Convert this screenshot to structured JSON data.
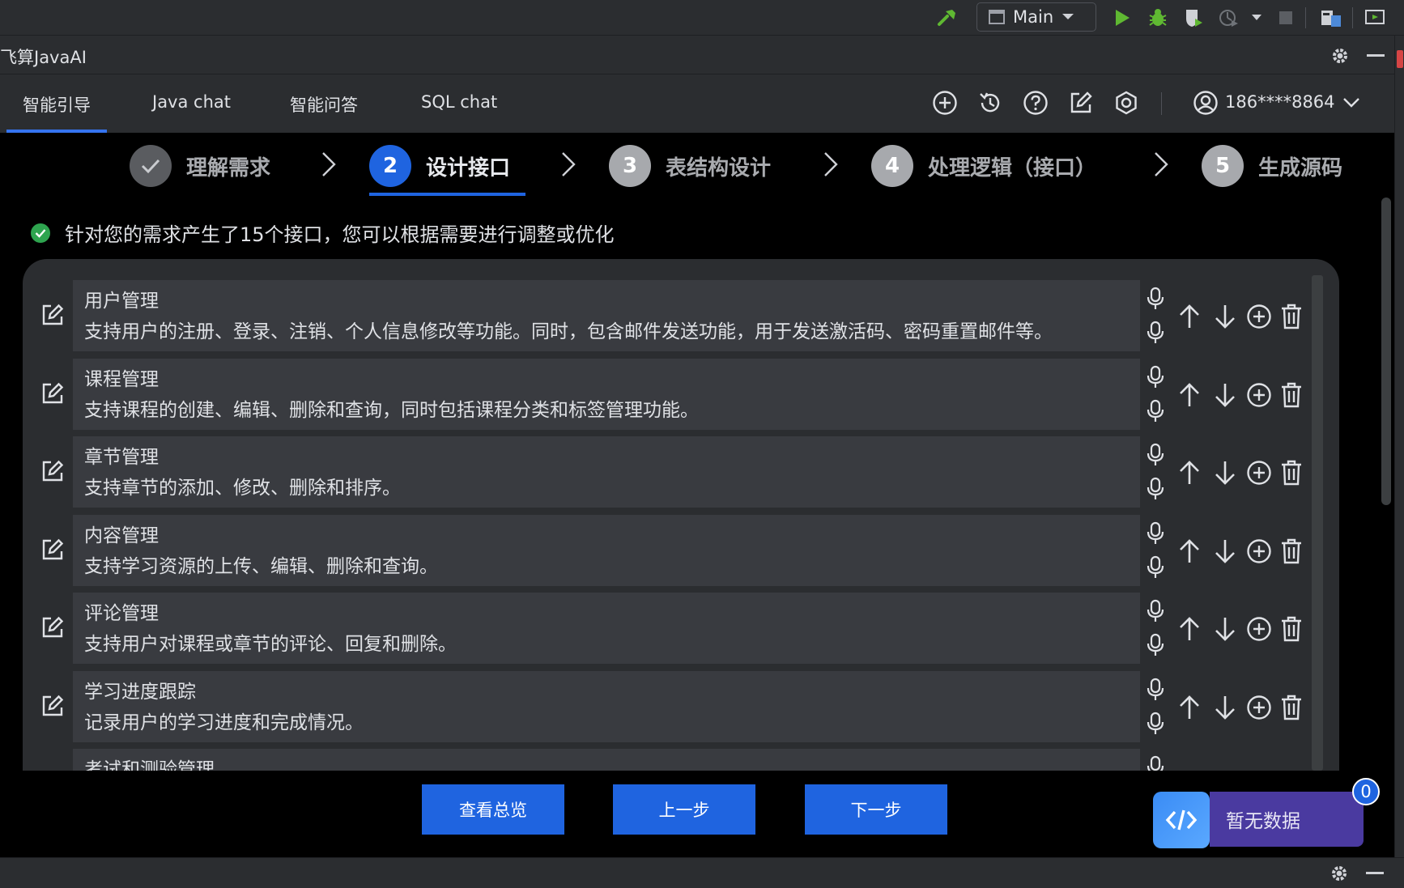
{
  "ide": {
    "run_config": "Main",
    "icons": [
      "build-hammer-icon",
      "run-icon",
      "debug-icon",
      "coverage-icon",
      "profile-icon",
      "stop-icon",
      "project-structure-icon",
      "presentation-icon"
    ]
  },
  "plugin": {
    "title": "飞算JavaAI"
  },
  "tabs": [
    {
      "label": "智能引导",
      "active": true
    },
    {
      "label": "Java chat",
      "active": false
    },
    {
      "label": "智能问答",
      "active": false
    },
    {
      "label": "SQL chat",
      "active": false
    }
  ],
  "header_actions": [
    "new-chat-icon",
    "history-icon",
    "help-icon",
    "edit-icon",
    "settings-hexagon-icon"
  ],
  "user": {
    "phone": "186****8864"
  },
  "stepper": [
    {
      "num": "✓",
      "label": "理解需求",
      "state": "done"
    },
    {
      "num": "2",
      "label": "设计接口",
      "state": "active"
    },
    {
      "num": "3",
      "label": "表结构设计",
      "state": "pending"
    },
    {
      "num": "4",
      "label": "处理逻辑（接口）",
      "state": "pending"
    },
    {
      "num": "5",
      "label": "生成源码",
      "state": "pending"
    }
  ],
  "message": "针对您的需求产生了15个接口，您可以根据需要进行调整或优化",
  "interfaces": [
    {
      "title": "用户管理",
      "desc": "支持用户的注册、登录、注销、个人信息修改等功能。同时，包含邮件发送功能，用于发送激活码、密码重置邮件等。"
    },
    {
      "title": "课程管理",
      "desc": "支持课程的创建、编辑、删除和查询，同时包括课程分类和标签管理功能。"
    },
    {
      "title": "章节管理",
      "desc": "支持章节的添加、修改、删除和排序。"
    },
    {
      "title": "内容管理",
      "desc": "支持学习资源的上传、编辑、删除和查询。"
    },
    {
      "title": "评论管理",
      "desc": "支持用户对课程或章节的评论、回复和删除。"
    },
    {
      "title": "学习进度跟踪",
      "desc": "记录用户的学习进度和完成情况。"
    },
    {
      "title": "考试和测验管理",
      "desc": ""
    }
  ],
  "buttons": {
    "overview": "查看总览",
    "prev": "上一步",
    "next": "下一步"
  },
  "code_widget": {
    "label": "暂无数据",
    "badge": "0"
  },
  "colors": {
    "accent": "#1f64e0",
    "panel": "#2b2d30",
    "card": "#393b40",
    "success": "#2ea44f"
  }
}
